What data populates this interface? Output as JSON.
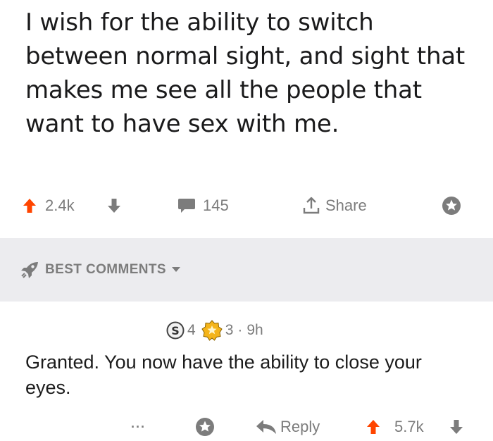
{
  "post": {
    "title": "I wish for the ability to switch between normal sight, and sight that makes me see all the people that want to have sex with me.",
    "upvotes": "2.4k",
    "comments": "145",
    "share_label": "Share"
  },
  "sort": {
    "label": "BEST COMMENTS"
  },
  "comment": {
    "award_silver_count": "4",
    "award_gold_count": "3",
    "separator": "·",
    "age": "9h",
    "body": "Granted. You now have the ability to close your eyes.",
    "more": "···",
    "reply_label": "Reply",
    "score": "5.7k"
  },
  "colors": {
    "upvote": "#ff4500",
    "muted": "#7c7c7c",
    "band": "#ececef",
    "award": "#f4b41a"
  },
  "icons": {
    "upvote": "arrow-up-icon",
    "downvote": "arrow-down-icon",
    "comment": "comment-bubble-icon",
    "share": "share-icon",
    "save": "save-icon",
    "sort": "rocket-icon",
    "reply": "reply-arrow-icon"
  }
}
